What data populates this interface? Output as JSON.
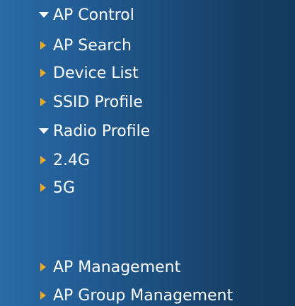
{
  "menu": {
    "items": [
      {
        "label": "AP Control",
        "state": "expanded"
      },
      {
        "label": "AP Search",
        "state": "collapsed"
      },
      {
        "label": "Device List",
        "state": "collapsed"
      },
      {
        "label": "SSID Profile",
        "state": "collapsed"
      },
      {
        "label": "Radio Profile",
        "state": "expanded"
      },
      {
        "label": "2.4G",
        "state": "collapsed"
      },
      {
        "label": "5G",
        "state": "collapsed"
      },
      {
        "label": "AP Management",
        "state": "collapsed"
      },
      {
        "label": "AP Group Management",
        "state": "collapsed"
      }
    ]
  },
  "colors": {
    "text": "#ffffff",
    "bullet_arrow": "#f3a925",
    "expand_arrow": "#ffffff",
    "background_start": "#2a6aa6",
    "background_end": "#133a5c"
  },
  "icons": {
    "expanded": "caret-down-icon",
    "collapsed": "caret-right-icon"
  }
}
